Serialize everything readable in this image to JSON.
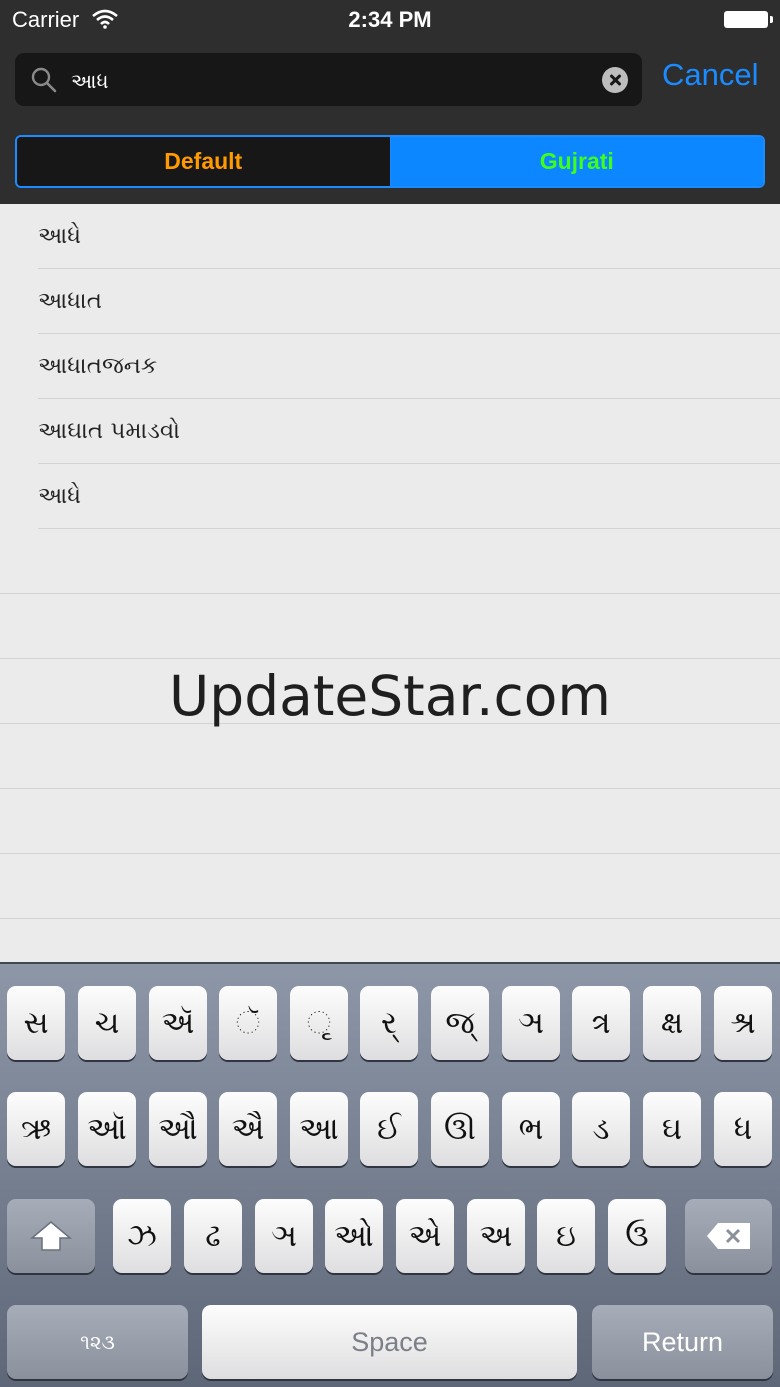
{
  "status_bar": {
    "carrier": "Carrier",
    "time": "2:34 PM"
  },
  "search": {
    "value": "આધ",
    "cancel_label": "Cancel"
  },
  "segments": [
    "Default",
    "Gujrati"
  ],
  "results": [
    "આધે",
    "આધાત",
    "આધાતજનક",
    "આઘાત પમાડવો",
    "આધે"
  ],
  "watermark": "UpdateStar.com",
  "keyboard": {
    "row1": [
      "સ",
      "ચ",
      "ઍ",
      "ૅ",
      "ૃ",
      "ર્",
      "જ્",
      "ઞ",
      "ત્ર",
      "ક્ષ",
      "શ્ર"
    ],
    "row2": [
      "ઋ",
      "ઑ",
      "ઔ",
      "ઐ",
      "આ",
      "ઈ",
      "ઊ",
      "ભ",
      "ડ",
      "ઘ",
      "ધ"
    ],
    "row3": [
      "ઝ",
      "ઢ",
      "ઞ",
      "ઓ",
      "એ",
      "અ",
      "ઇ",
      "ઉ"
    ],
    "numbers_label": "૧૨૩",
    "space_label": "Space",
    "return_label": "Return"
  },
  "colors": {
    "accent": "#1a8cff",
    "default_segment_text": "#ff9a00",
    "gujrati_segment_text": "#3dff1a",
    "header_bg": "#2e2e2e"
  },
  "icons": [
    "wifi-icon",
    "battery-icon",
    "search-icon",
    "clear-icon",
    "shift-icon",
    "backspace-icon"
  ]
}
